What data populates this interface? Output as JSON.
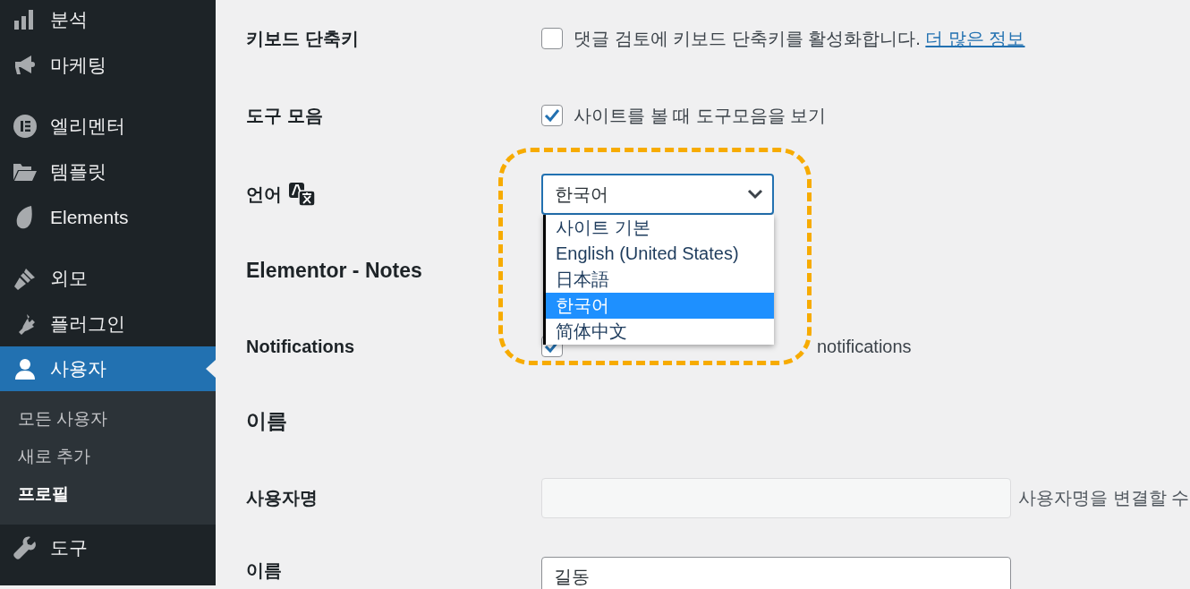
{
  "sidebar": {
    "groups": [
      [
        {
          "label": "분석",
          "active": false
        },
        {
          "label": "마케팅",
          "active": false
        }
      ],
      [
        {
          "label": "엘리멘터",
          "active": false
        },
        {
          "label": "템플릿",
          "active": false
        },
        {
          "label": "Elements",
          "active": false
        }
      ],
      [
        {
          "label": "외모",
          "active": false
        },
        {
          "label": "플러그인",
          "active": false
        },
        {
          "label": "사용자",
          "active": true,
          "children": [
            {
              "label": "모든 사용자",
              "selected": false
            },
            {
              "label": "새로 추가",
              "selected": false
            },
            {
              "label": "프로필",
              "selected": true
            }
          ]
        },
        {
          "label": "도구",
          "active": false
        }
      ]
    ]
  },
  "settings": [
    {
      "kind": "checkbox",
      "label": "키보드 단축키",
      "text": "댓글 검토에 키보드 단축키를 활성화합니다.",
      "link": "더 많은 정보",
      "checked": false
    },
    {
      "kind": "checkbox",
      "label": "도구 모음",
      "text": "사이트를 볼 때 도구모음을 보기",
      "checked": true
    },
    {
      "kind": "select",
      "label": "언어",
      "value": "한국어",
      "expanded": true,
      "highlighted": true,
      "options": [
        {
          "label": "사이트 기본",
          "selected": false
        },
        {
          "label": "English (United States)",
          "selected": false
        },
        {
          "label": "日本語",
          "selected": false
        },
        {
          "label": "한국어",
          "selected": true
        },
        {
          "label": "简体中文",
          "selected": false
        }
      ]
    },
    {
      "kind": "heading",
      "label": "Elementor - Notes"
    },
    {
      "kind": "checkbox",
      "label": "Notifications",
      "text": "notifications",
      "covered": true,
      "checked": true
    },
    {
      "kind": "heading",
      "label": "이름"
    },
    {
      "kind": "text-field",
      "label": "사용자명",
      "disabled": true,
      "description": "사용자명을 변결할 수"
    },
    {
      "kind": "text-field",
      "label": "이름",
      "value": "길동",
      "disabled": false
    }
  ]
}
